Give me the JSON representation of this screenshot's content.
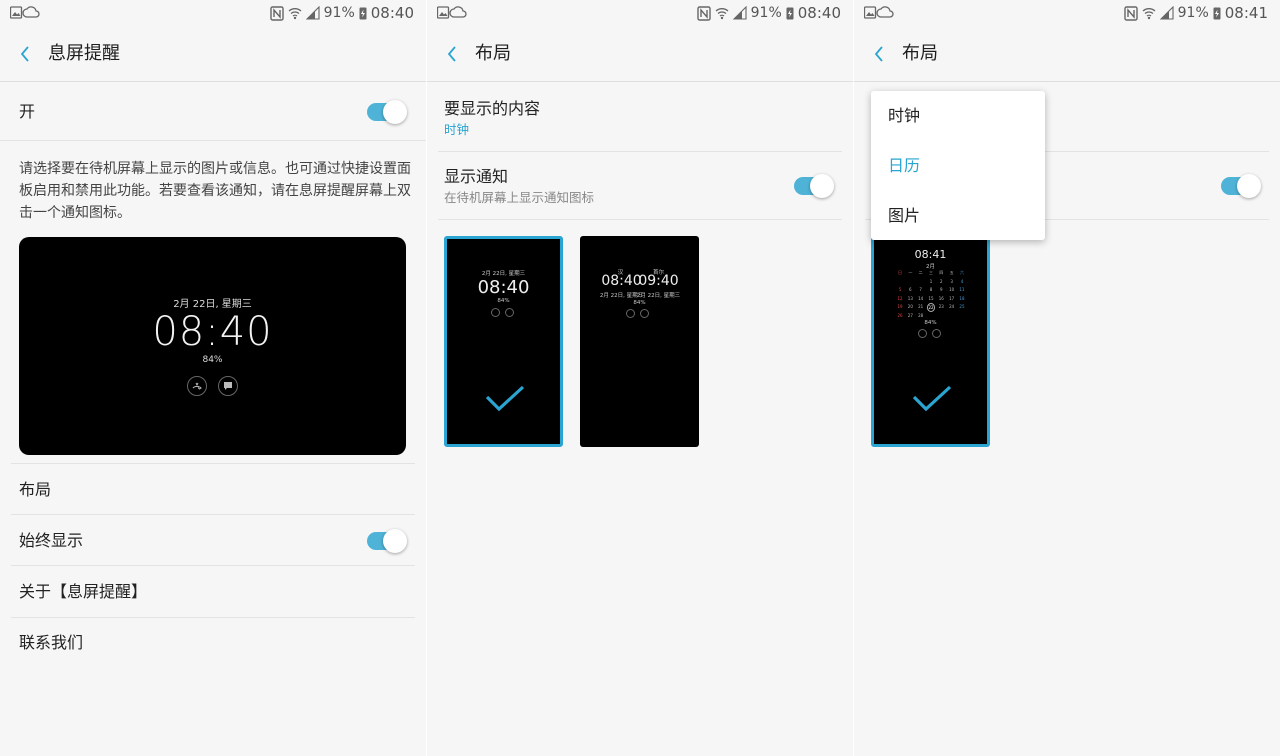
{
  "status": [
    {
      "battery": "91%",
      "time": "08:40"
    },
    {
      "battery": "91%",
      "time": "08:40"
    },
    {
      "battery": "91%",
      "time": "08:41"
    }
  ],
  "panel1": {
    "title": "息屏提醒",
    "toggle_on_label": "开",
    "description": "请选择要在待机屏幕上显示的图片或信息。也可通过快捷设置面板启用和禁用此功能。若要查看该通知，请在息屏提醒屏幕上双击一个通知图标。",
    "preview": {
      "date": "2月 22日, 星期三",
      "time": "08:40",
      "battery": "84%"
    },
    "items": [
      "布局",
      "始终显示",
      "关于【息屏提醒】",
      "联系我们"
    ]
  },
  "panel2": {
    "title": "布局",
    "content_label": "要显示的内容",
    "content_value": "时钟",
    "notify_label": "显示通知",
    "notify_sub": "在待机屏幕上显示通知图标",
    "thumb1": {
      "date": "2月 22日, 星期三",
      "time": "08:40",
      "battery": "84%"
    },
    "thumb2": {
      "left_label": "汉",
      "right_label": "首尔",
      "left_time": "08:40",
      "right_time": "09:40",
      "left_date": "2月 22日, 星期三",
      "right_date": "2月 22日, 星期三",
      "battery": "84%"
    }
  },
  "panel3": {
    "title": "布局",
    "menu": [
      "时钟",
      "日历",
      "图片"
    ],
    "menu_selected_index": 1,
    "thumb": {
      "time": "08:41",
      "month": "2月",
      "battery": "84%",
      "weekdays": [
        "日",
        "一",
        "二",
        "三",
        "四",
        "五",
        "六"
      ],
      "weeks": [
        [
          "",
          "",
          "",
          "1",
          "2",
          "3",
          "4"
        ],
        [
          "5",
          "6",
          "7",
          "8",
          "9",
          "10",
          "11"
        ],
        [
          "12",
          "13",
          "14",
          "15",
          "16",
          "17",
          "18"
        ],
        [
          "19",
          "20",
          "21",
          "22",
          "23",
          "24",
          "25"
        ],
        [
          "26",
          "27",
          "28",
          "",
          "",
          "",
          ""
        ]
      ],
      "today": "22"
    }
  },
  "colors": {
    "accent": "#2aa4d0",
    "toggle": "#4fb3d7",
    "background": "#f6f6f6"
  },
  "icons": [
    "gallery-icon",
    "cloud-icon",
    "nfc-icon",
    "wifi-icon",
    "signal-icon",
    "battery-charging-icon",
    "back-arrow-icon",
    "missed-call-icon",
    "message-icon",
    "checkmark-icon"
  ]
}
